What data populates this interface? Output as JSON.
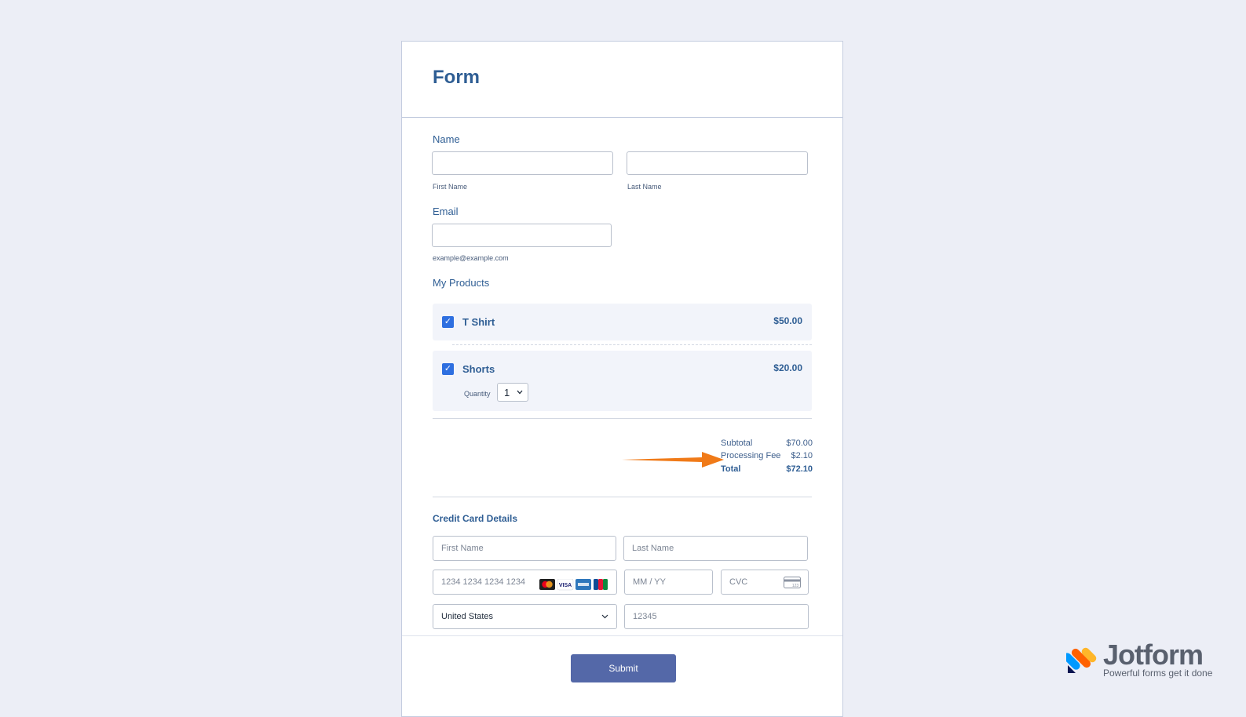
{
  "form": {
    "title": "Form",
    "name": {
      "label": "Name",
      "first_sublabel": "First Name",
      "last_sublabel": "Last Name",
      "first_value": "",
      "last_value": ""
    },
    "email": {
      "label": "Email",
      "sublabel": "example@example.com",
      "value": ""
    },
    "products": {
      "label": "My Products",
      "items": [
        {
          "name": "T Shirt",
          "price": "$50.00",
          "checked": true
        },
        {
          "name": "Shorts",
          "price": "$20.00",
          "checked": true,
          "quantity_label": "Quantity",
          "quantity": "1"
        }
      ]
    },
    "summary": {
      "subtotal_label": "Subtotal",
      "subtotal_value": "$70.00",
      "fee_label": "Processing Fee",
      "fee_value": "$2.10",
      "total_label": "Total",
      "total_value": "$72.10"
    },
    "credit_card": {
      "title": "Credit Card Details",
      "first_name_placeholder": "First Name",
      "last_name_placeholder": "Last Name",
      "card_number_placeholder": "1234 1234 1234 1234",
      "expiry_placeholder": "MM / YY",
      "cvc_placeholder": "CVC",
      "cvc_icon_text": "123",
      "country": "United States",
      "postal_placeholder": "12345",
      "card_brands": [
        {
          "name": "mastercard",
          "color": "#eb001b"
        },
        {
          "name": "VISA",
          "color": "#1a1f71"
        },
        {
          "name": "amex",
          "color": "#2e77bc"
        },
        {
          "name": "jcb",
          "color": "#0b8a3e"
        }
      ]
    },
    "submit_label": "Submit"
  },
  "annotation": {
    "arrow_color": "#f07a18"
  },
  "branding": {
    "name": "Jotform",
    "tagline": "Powerful forms get it done"
  },
  "colors": {
    "accent": "#2f5e94",
    "submit": "#5468a8",
    "checkbox": "#2e6fe0",
    "background": "#eceef6"
  }
}
